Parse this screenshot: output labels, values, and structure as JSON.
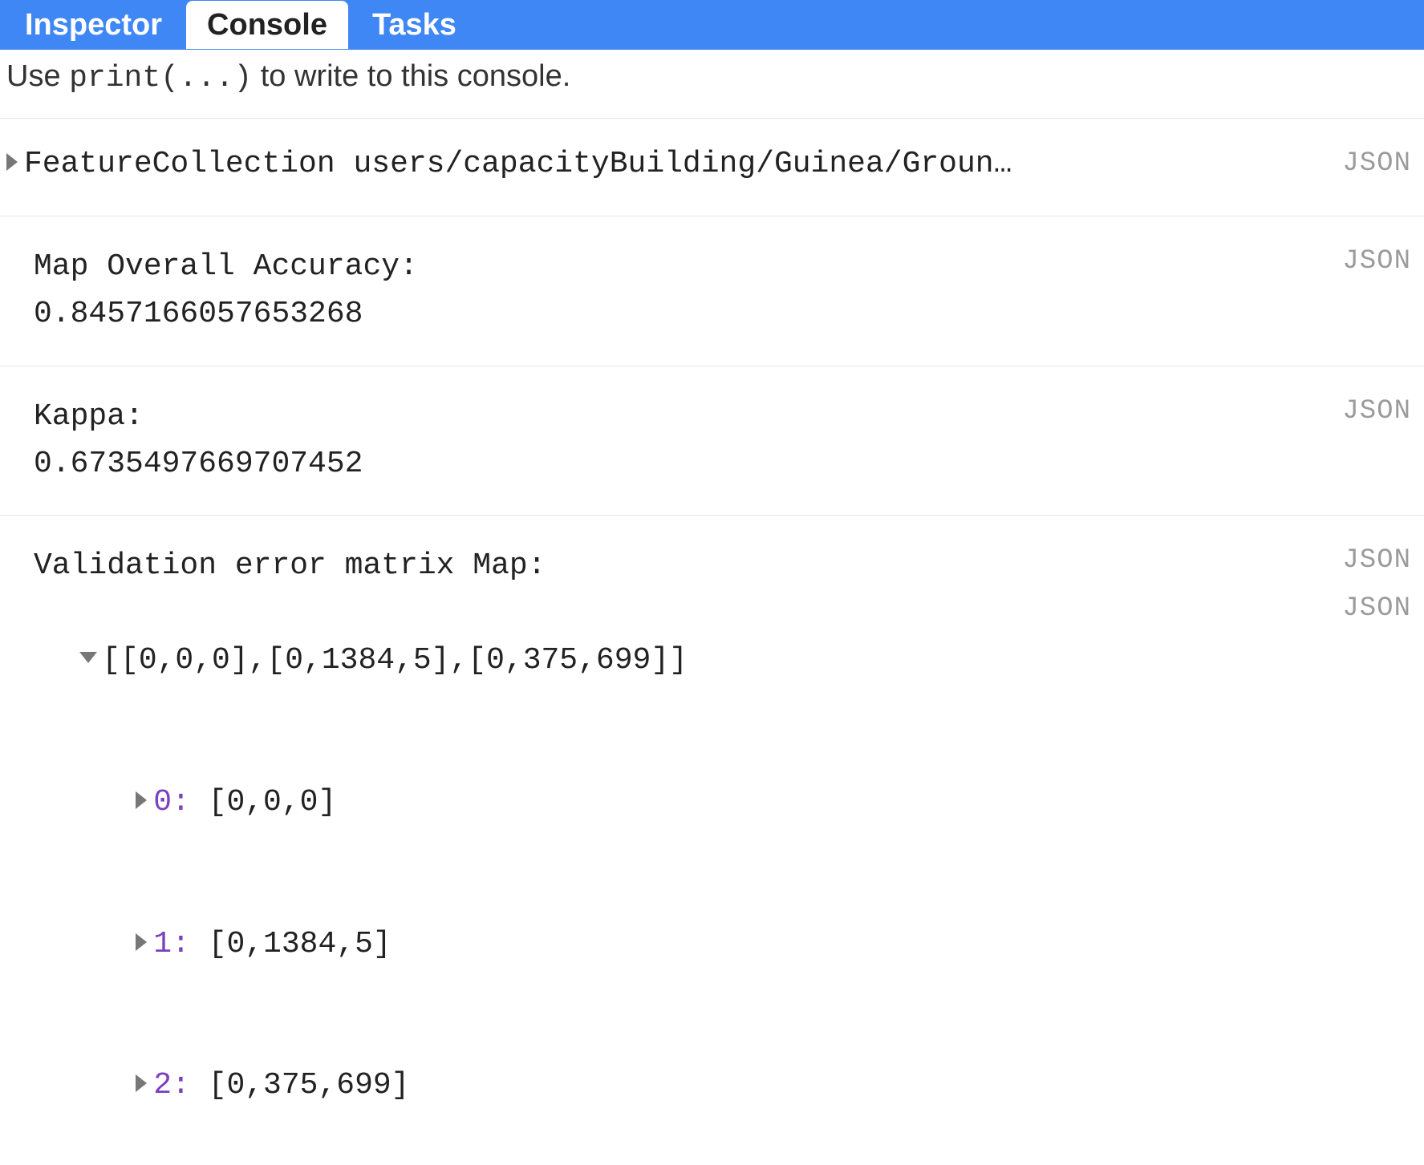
{
  "tabs": {
    "inspector": "Inspector",
    "console": "Console",
    "tasks": "Tasks"
  },
  "hint_prefix": "Use ",
  "hint_code": "print(...)",
  "hint_suffix": " to write to this console.",
  "json_label": "JSON",
  "entries": {
    "fc": "FeatureCollection users/capacityBuilding/Guinea/Groun…",
    "acc_label": "Map Overall Accuracy:",
    "acc_value": "0.8457166057653268",
    "kappa_label": "Kappa:",
    "kappa_value": "0.6735497669707452",
    "matrix_label": "Validation error matrix Map:",
    "matrix_summary": "[[0,0,0],[0,1384,5],[0,375,699]]",
    "matrix_rows": [
      {
        "idx": "0:",
        "val": "[0,0,0]"
      },
      {
        "idx": "1:",
        "val": "[0,1384,5]"
      },
      {
        "idx": "2:",
        "val": "[0,375,699]"
      }
    ]
  }
}
